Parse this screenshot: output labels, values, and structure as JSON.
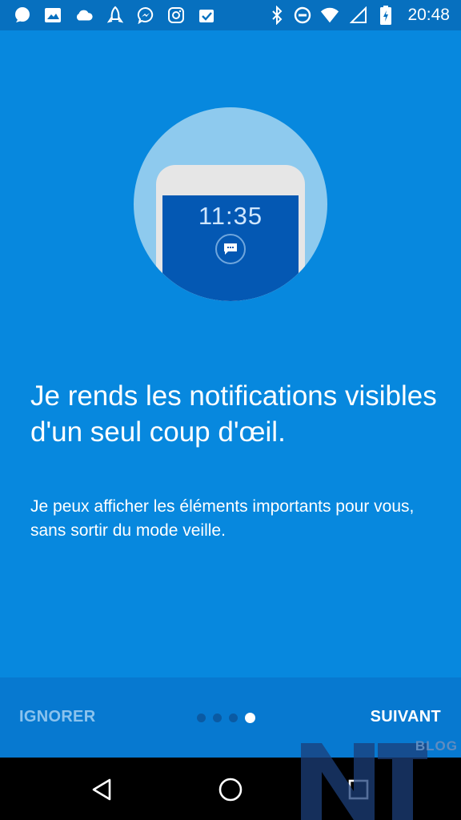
{
  "status_bar": {
    "time": "20:48",
    "left_icons": [
      "chat-bubble-icon",
      "image-icon",
      "cloud-icon",
      "rocket-icon",
      "messenger-icon",
      "instagram-icon",
      "clipboard-check-icon"
    ],
    "right_icons": [
      "bluetooth-icon",
      "do-not-disturb-icon",
      "wifi-icon",
      "signal-icon",
      "battery-charging-icon"
    ]
  },
  "illustration": {
    "phone_time": "11:35",
    "notification_icon": "message-bubble-icon"
  },
  "headline": "Je rends les notifications visibles d'un seul coup d'œil.",
  "body": "Je peux afficher les éléments importants pour vous, sans sortir du mode veille.",
  "bottom_bar": {
    "skip_label": "IGNORER",
    "next_label": "SUIVANT",
    "page_indicator": {
      "total": 4,
      "current": 4
    }
  },
  "nav_bar": {
    "buttons": [
      "back-icon",
      "home-icon",
      "recents-icon"
    ]
  },
  "watermark": {
    "label": "BLOG"
  },
  "colors": {
    "background": "#0788de",
    "status_bar": "#0770bf",
    "bottom_bar": "#0779d0",
    "hero_circle": "#8ecaee",
    "phone_screen": "#0458b3"
  }
}
